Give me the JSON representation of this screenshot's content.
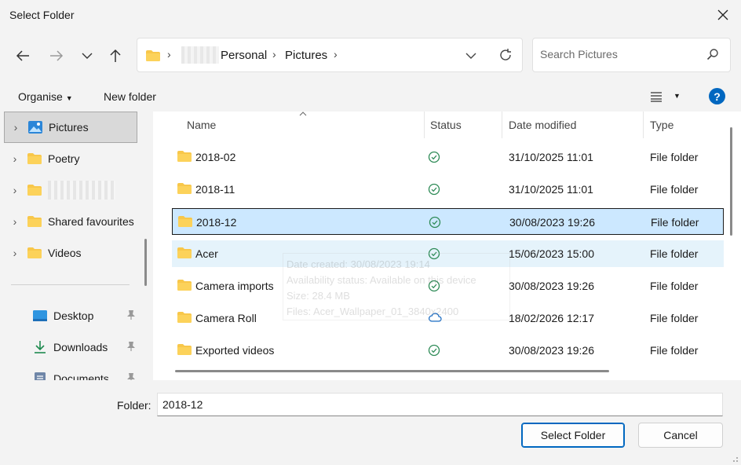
{
  "window": {
    "title": "Select Folder"
  },
  "nav": {
    "breadcrumbs": [
      "Personal",
      "Pictures"
    ],
    "search_placeholder": "Search Pictures"
  },
  "toolbar": {
    "organise": "Organise",
    "new_folder": "New folder",
    "help": "?"
  },
  "sidebar": {
    "items": [
      {
        "label": "Pictures",
        "icon": "pictures-icon",
        "selected": true
      },
      {
        "label": "Poetry",
        "icon": "folder-icon"
      },
      {
        "label": "",
        "icon": "folder-icon",
        "redacted": true
      },
      {
        "label": "Shared favourites",
        "icon": "folder-icon"
      },
      {
        "label": "Videos",
        "icon": "folder-icon"
      }
    ],
    "quick_access": [
      {
        "label": "Desktop",
        "icon": "desktop-icon"
      },
      {
        "label": "Downloads",
        "icon": "download-icon"
      },
      {
        "label": "Documents",
        "icon": "documents-icon"
      }
    ]
  },
  "columns": {
    "name": "Name",
    "status": "Status",
    "date": "Date modified",
    "type": "Type"
  },
  "files": [
    {
      "name": "2018-02",
      "status": "synced",
      "date": "31/10/2025 11:01",
      "type": "File folder"
    },
    {
      "name": "2018-11",
      "status": "synced",
      "date": "31/10/2025 11:01",
      "type": "File folder"
    },
    {
      "name": "2018-12",
      "status": "synced",
      "date": "30/08/2023 19:26",
      "type": "File folder",
      "selected": true
    },
    {
      "name": "Acer",
      "status": "synced",
      "date": "15/06/2023 15:00",
      "type": "File folder",
      "hover": true
    },
    {
      "name": "Camera imports",
      "status": "synced",
      "date": "30/08/2023 19:26",
      "type": "File folder"
    },
    {
      "name": "Camera Roll",
      "status": "cloud",
      "date": "18/02/2026 12:17",
      "type": "File folder"
    },
    {
      "name": "Exported videos",
      "status": "synced",
      "date": "30/08/2023 19:26",
      "type": "File folder"
    }
  ],
  "tooltip": {
    "created": "Date created: 30/08/2023 19:14",
    "availability": "Availability status: Available on this device",
    "size": "Size: 28.4 MB",
    "files": "Files: Acer_Wallpaper_01_3840x2400"
  },
  "footer": {
    "folder_label": "Folder:",
    "folder_value": "2018-12",
    "select_button": "Select Folder",
    "cancel_button": "Cancel"
  },
  "colors": {
    "accent": "#0067c0",
    "selected_row": "#cce8ff",
    "hover_row": "#e5f3fb",
    "folder": "#f8c74a",
    "synced": "#2e8b57",
    "cloud": "#1f6fc5"
  }
}
